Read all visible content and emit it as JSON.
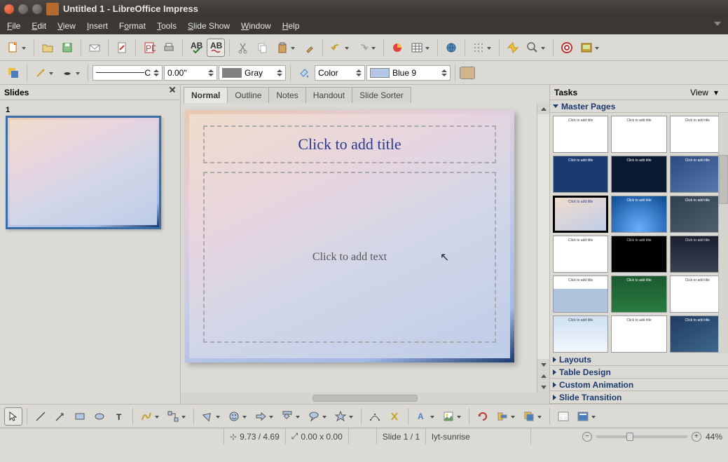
{
  "window": {
    "title": "Untitled 1 - LibreOffice Impress"
  },
  "menubar": [
    "File",
    "Edit",
    "View",
    "Insert",
    "Format",
    "Tools",
    "Slide Show",
    "Window",
    "Help"
  ],
  "toolbar2": {
    "linestyle": "C",
    "linewidth": "0.00\"",
    "linecolor": {
      "name": "Gray",
      "hex": "#808080"
    },
    "fillmode": "Color",
    "fillcolor": {
      "name": "Blue 9",
      "hex": "#b3c8e7"
    },
    "areaswatch": "#d2b48c"
  },
  "slidespanel": {
    "title": "Slides",
    "items": [
      {
        "num": "1"
      }
    ]
  },
  "viewtabs": [
    "Normal",
    "Outline",
    "Notes",
    "Handout",
    "Slide Sorter"
  ],
  "active_tab": 0,
  "slide": {
    "title_placeholder": "Click to add title",
    "text_placeholder": "Click to add text"
  },
  "tasks": {
    "title": "Tasks",
    "view_label": "View",
    "groups": {
      "masters": "Master Pages",
      "layouts": "Layouts",
      "table": "Table Design",
      "anim": "Custom Animation",
      "trans": "Slide Transition"
    },
    "masters": [
      {
        "bg": "#ffffff",
        "txt": "#444"
      },
      {
        "bg": "#ffffff",
        "txt": "#444"
      },
      {
        "bg": "#ffffff",
        "txt": "#444"
      },
      {
        "bg": "#1a3a70",
        "txt": "#fff"
      },
      {
        "bg": "#0a1a30",
        "txt": "#fff"
      },
      {
        "bg": "linear-gradient(150deg,#2a4a80,#5a7ab0)",
        "txt": "#fff"
      },
      {
        "bg": "linear-gradient(155deg,#f0dccb,#bfcde8)",
        "txt": "#2b3a8f",
        "sel": true
      },
      {
        "bg": "radial-gradient(circle at 50% 90%,#6ab0ff,#0a4a90)",
        "txt": "#fff"
      },
      {
        "bg": "linear-gradient(150deg,#304050,#506070)",
        "txt": "#fff"
      },
      {
        "bg": "#ffffff",
        "txt": "#444"
      },
      {
        "bg": "#000000",
        "txt": "#ccc"
      },
      {
        "bg": "linear-gradient(#1a2030,#3a4050)",
        "txt": "#ddd"
      },
      {
        "bg": "linear-gradient(#ffffff 35%,#b0c4de 35%)",
        "txt": "#444"
      },
      {
        "bg": "linear-gradient(#1a5a30,#2a7a40)",
        "txt": "#fff"
      },
      {
        "bg": "#ffffff",
        "txt": "#444"
      },
      {
        "bg": "linear-gradient(#d0e0f0,#f0f6fc)",
        "txt": "#345"
      },
      {
        "bg": "#ffffff",
        "txt": "#444"
      },
      {
        "bg": "linear-gradient(150deg,#203a60,#406a90)",
        "txt": "#fff"
      }
    ]
  },
  "statusbar": {
    "pos": "9.73 / 4.69",
    "size": "0.00 x 0.00",
    "slideno": "Slide 1 / 1",
    "layout": "lyt-sunrise",
    "zoom": "44%"
  }
}
